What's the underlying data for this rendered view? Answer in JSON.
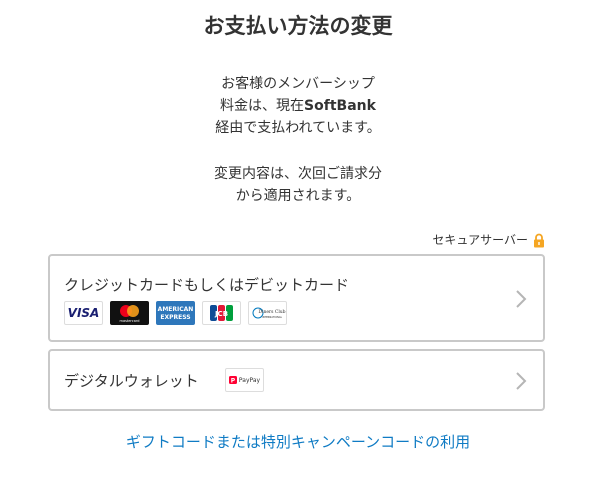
{
  "page": {
    "title": "お支払い方法の変更"
  },
  "info": {
    "line1": "お客様のメンバーシップ",
    "line2_prefix": "料金は、現在",
    "line2_bold": "SoftBank",
    "line3": "経由で支払われています。",
    "line4": "変更内容は、次回ご請求分",
    "line5": "から適用されます。"
  },
  "secure": {
    "label": "セキュアサーバー",
    "icon": "lock-icon",
    "icon_color": "#f5a623"
  },
  "options": {
    "card": {
      "label": "クレジットカードもしくはデビットカード",
      "logos": {
        "visa": "VISA",
        "mastercard": "mastercard",
        "amex_top": "AMERICAN",
        "amex_bottom": "EXPRESS",
        "jcb": "JCB",
        "diners_top": "Diners Club",
        "diners_bottom": "INTERNATIONAL"
      },
      "icon": "chevron-right-icon"
    },
    "wallet": {
      "label": "デジタルウォレット",
      "paypay": "PayPay",
      "icon": "chevron-right-icon"
    }
  },
  "links": {
    "gift": "ギフトコードまたは特別キャンペーンコードの利用"
  },
  "colors": {
    "link": "#0f7bc4",
    "card_border": "#c9c9c9",
    "text": "#333333",
    "visa_blue": "#1a1f71",
    "mastercard_red": "#eb001b",
    "mastercard_orange": "#f79e1b",
    "amex_blue": "#2e77bb",
    "jcb_blue": "#0e4c96",
    "jcb_red": "#e21836",
    "jcb_green": "#009f3c",
    "paypay_red": "#ff0033"
  }
}
